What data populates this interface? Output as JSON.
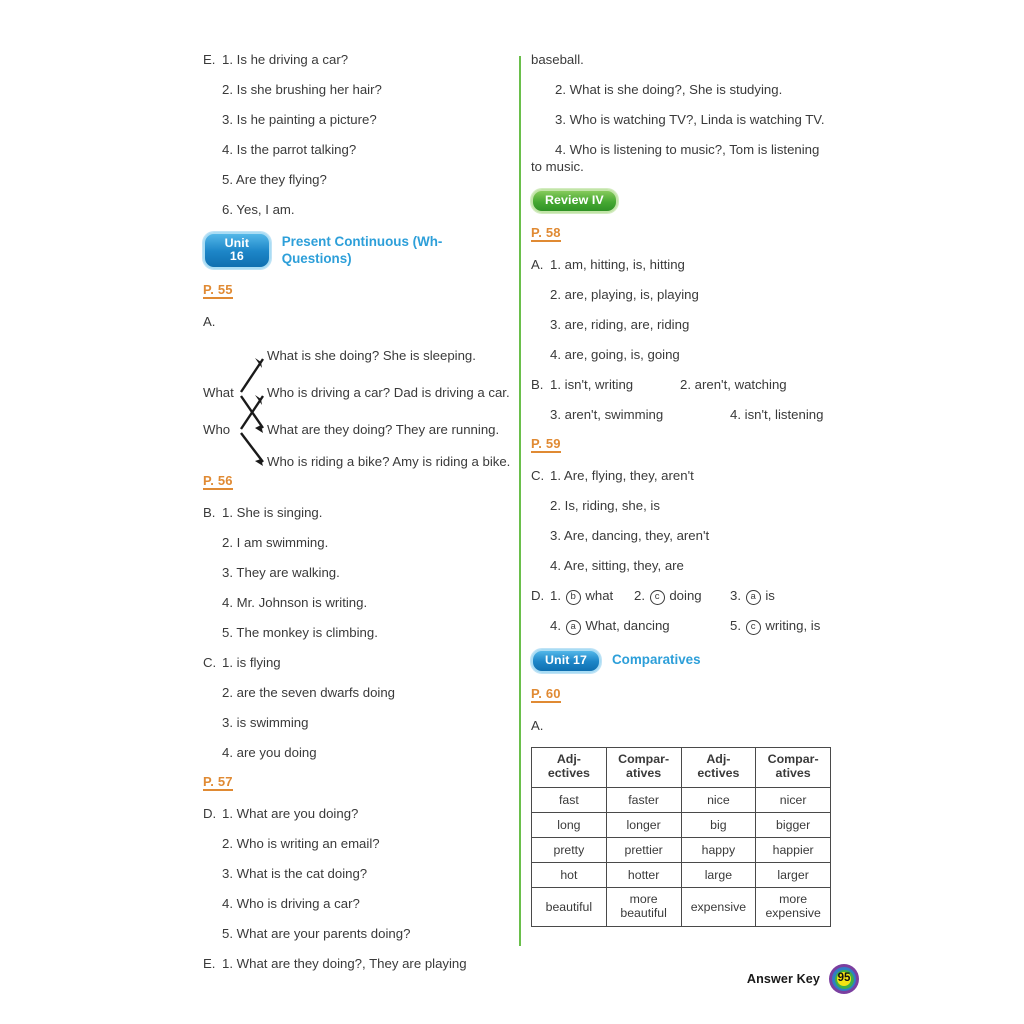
{
  "left_column": {
    "section_e_prev": {
      "letter": "E.",
      "items": [
        "1. Is he driving a car?",
        "2. Is she brushing her hair?",
        "3. Is he painting a picture?",
        "4. Is the parrot talking?",
        "5. Are they flying?",
        "6. Yes, I am."
      ]
    },
    "unit": {
      "badge": "Unit 16",
      "title": "Present Continuous (Wh- Questions)",
      "badge_color": "#1d86c8",
      "title_color": "#2d9fd9"
    },
    "page_55": "P. 55",
    "section_a_letter": "A.",
    "diagram": {
      "left_words": [
        "What",
        "Who"
      ],
      "right_lines": [
        "What is she doing? She is sleeping.",
        "Who is driving a car? Dad is driving a car.",
        "What are they doing? They are running.",
        "Who is riding a bike? Amy is riding a bike."
      ]
    },
    "page_56": "P. 56",
    "section_b": {
      "letter": "B.",
      "items": [
        "1. She is singing.",
        "2. I am swimming.",
        "3. They are walking.",
        "4. Mr. Johnson is writing.",
        "5. The monkey is climbing."
      ]
    },
    "section_c": {
      "letter": "C.",
      "items": [
        "1. is flying",
        "2. are the seven dwarfs doing",
        "3. is swimming",
        "4. are you doing"
      ]
    },
    "page_57": "P. 57",
    "section_d": {
      "letter": "D.",
      "items": [
        "1. What are you doing?",
        "2. Who is writing an email?",
        "3. What is the cat doing?",
        "4. Who is driving a car?",
        "5. What are your parents doing?"
      ]
    },
    "section_e": {
      "letter": "E.",
      "item_1": "1. What are they doing?, They are playing"
    }
  },
  "right_column": {
    "continued_word": "baseball.",
    "section_e_cont": [
      "2. What is she doing?, She is studying.",
      "3. Who is watching TV?, Linda is watching TV.",
      "4. Who is listening to music?, Tom is listening to music."
    ],
    "review": {
      "badge": "Review IV",
      "badge_color": "#46a832"
    },
    "page_58": "P. 58",
    "section_a": {
      "letter": "A.",
      "items": [
        "1. am, hitting, is, hitting",
        "2. are, playing, is, playing",
        "3. are, riding, are, riding",
        "4. are, going, is, going"
      ]
    },
    "section_b": {
      "letter": "B.",
      "row1": [
        "1. isn't, writing",
        "2. aren't, watching"
      ],
      "row2": [
        "3. aren't, swimming",
        "4. isn't, listening"
      ]
    },
    "page_59": "P. 59",
    "section_c": {
      "letter": "C.",
      "items": [
        "1. Are, flying, they, aren't",
        "2. Is, riding, she, is",
        "3. Are, dancing, they, aren't",
        "4. Are, sitting, they, are"
      ]
    },
    "section_d": {
      "letter": "D.",
      "row1": [
        {
          "num": "1.",
          "circle": "b",
          "text": "what"
        },
        {
          "num": "2.",
          "circle": "c",
          "text": "doing"
        },
        {
          "num": "3.",
          "circle": "a",
          "text": "is"
        }
      ],
      "row2": [
        {
          "num": "4.",
          "circle": "a",
          "text": "What, dancing"
        },
        {
          "num": "5.",
          "circle": "c",
          "text": "writing, is"
        }
      ]
    },
    "unit": {
      "badge": "Unit 17",
      "title": "Comparatives",
      "badge_color": "#1d86c8",
      "title_color": "#2d9fd9"
    },
    "page_60": "P. 60",
    "section_a2_letter": "A.",
    "table": {
      "headers": [
        {
          "l1": "Adj-",
          "l2": "ectives"
        },
        {
          "l1": "Compar-",
          "l2": "atives"
        },
        {
          "l1": "Adj-",
          "l2": "ectives"
        },
        {
          "l1": "Compar-",
          "l2": "atives"
        }
      ],
      "rows": [
        [
          {
            "l1": "fast",
            "l2": ""
          },
          {
            "l1": "faster",
            "l2": ""
          },
          {
            "l1": "nice",
            "l2": ""
          },
          {
            "l1": "nicer",
            "l2": ""
          }
        ],
        [
          {
            "l1": "long",
            "l2": ""
          },
          {
            "l1": "longer",
            "l2": ""
          },
          {
            "l1": "big",
            "l2": ""
          },
          {
            "l1": "bigger",
            "l2": ""
          }
        ],
        [
          {
            "l1": "pretty",
            "l2": ""
          },
          {
            "l1": "prettier",
            "l2": ""
          },
          {
            "l1": "happy",
            "l2": ""
          },
          {
            "l1": "happier",
            "l2": ""
          }
        ],
        [
          {
            "l1": "hot",
            "l2": ""
          },
          {
            "l1": "hotter",
            "l2": ""
          },
          {
            "l1": "large",
            "l2": ""
          },
          {
            "l1": "larger",
            "l2": ""
          }
        ],
        [
          {
            "l1": "beautiful",
            "l2": ""
          },
          {
            "l1": "more",
            "l2": "beautiful"
          },
          {
            "l1": "expensive",
            "l2": ""
          },
          {
            "l1": "more",
            "l2": "expensive"
          }
        ]
      ]
    }
  },
  "footer": {
    "label": "Answer Key",
    "page_number": "95"
  }
}
